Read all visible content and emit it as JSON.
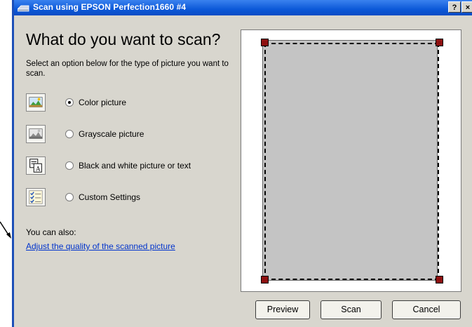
{
  "window": {
    "title": "Scan using EPSON Perfection1660 #4",
    "help_button": "?",
    "close_button": "×"
  },
  "main": {
    "heading": "What do you want to scan?",
    "instruction": "Select an option below for the type of picture you want to scan.",
    "options": [
      {
        "label": "Color picture",
        "selected": true,
        "icon": "color-picture-icon"
      },
      {
        "label": "Grayscale picture",
        "selected": false,
        "icon": "grayscale-picture-icon"
      },
      {
        "label": "Black and white picture or text",
        "selected": false,
        "icon": "black-white-picture-icon"
      },
      {
        "label": "Custom Settings",
        "selected": false,
        "icon": "custom-settings-icon"
      }
    ],
    "also_label": "You can also:",
    "link_label": "Adjust the quality of the scanned picture"
  },
  "buttons": {
    "preview": "Preview",
    "scan": "Scan",
    "cancel": "Cancel"
  },
  "colors": {
    "titlebar": "#0c58d8",
    "window_bg": "#d8d6ce",
    "link": "#0033cc",
    "crop_handle": "#8e1010",
    "preview_page": "#c4c4c4"
  }
}
